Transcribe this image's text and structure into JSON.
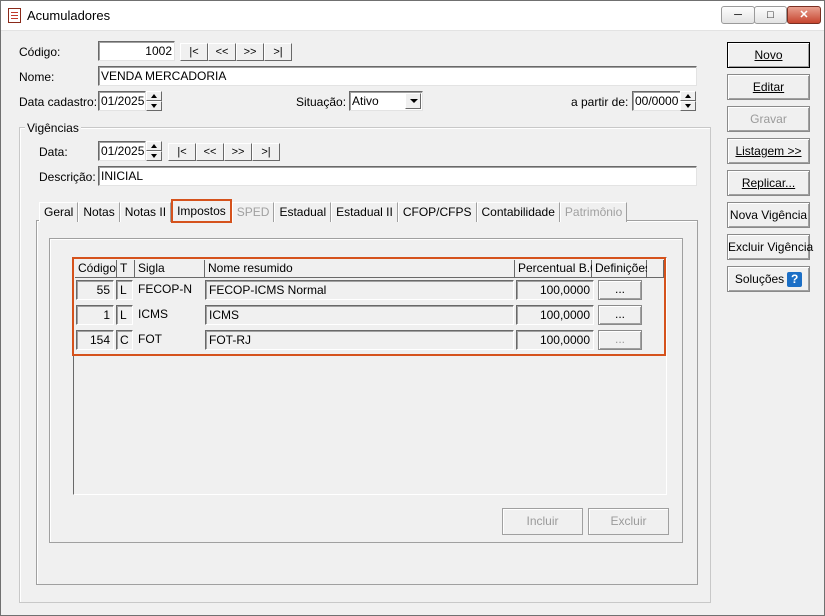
{
  "window": {
    "title": "Acumuladores"
  },
  "header": {
    "codigo_label": "Código:",
    "codigo_value": "1002",
    "nome_label": "Nome:",
    "nome_value": "VENDA MERCADORIA",
    "data_cadastro_label": "Data cadastro:",
    "data_cadastro_value": "01/2025",
    "situacao_label": "Situação:",
    "situacao_value": "Ativo",
    "a_partir_label": "a partir de:",
    "a_partir_value": "00/0000",
    "nav": [
      "|<",
      "<<",
      ">>",
      ">|"
    ]
  },
  "vigencias": {
    "title": "Vigências",
    "data_label": "Data:",
    "data_value": "01/2025",
    "descricao_label": "Descrição:",
    "descricao_value": "INICIAL",
    "nav": [
      "|<",
      "<<",
      ">>",
      ">|"
    ]
  },
  "tabs": [
    {
      "label": "Geral",
      "state": "normal"
    },
    {
      "label": "Notas",
      "state": "normal"
    },
    {
      "label": "Notas II",
      "state": "normal"
    },
    {
      "label": "Impostos",
      "state": "active"
    },
    {
      "label": "SPED",
      "state": "disabled"
    },
    {
      "label": "Estadual",
      "state": "normal"
    },
    {
      "label": "Estadual II",
      "state": "normal"
    },
    {
      "label": "CFOP/CFPS",
      "state": "normal"
    },
    {
      "label": "Contabilidade",
      "state": "normal"
    },
    {
      "label": "Patrimônio",
      "state": "disabled"
    }
  ],
  "grid": {
    "columns": [
      "Código",
      "T",
      "Sigla",
      "Nome resumido",
      "Percentual B.C.",
      "Definições"
    ],
    "rows": [
      {
        "codigo": "55",
        "t": "L",
        "sigla": "FECOP-N",
        "nome": "FECOP-ICMS Normal",
        "percentual": "100,0000",
        "definicoes": "...",
        "def_enabled": true
      },
      {
        "codigo": "1",
        "t": "L",
        "sigla": "ICMS",
        "nome": "ICMS",
        "percentual": "100,0000",
        "definicoes": "...",
        "def_enabled": true
      },
      {
        "codigo": "154",
        "t": "C",
        "sigla": "FOT",
        "nome": "FOT-RJ",
        "percentual": "100,0000",
        "definicoes": "...",
        "def_enabled": false
      }
    ]
  },
  "grid_buttons": {
    "incluir": "Incluir",
    "excluir": "Excluir"
  },
  "side_buttons": [
    {
      "label": "Novo",
      "state": "default"
    },
    {
      "label": "Editar",
      "state": "normal"
    },
    {
      "label": "Gravar",
      "state": "disabled"
    },
    {
      "label": "Listagem >>",
      "state": "normal"
    },
    {
      "label": "Replicar...",
      "state": "normal"
    },
    {
      "label": "Nova Vigência",
      "state": "normal"
    },
    {
      "label": "Excluir Vigência",
      "state": "normal"
    },
    {
      "label": "Soluções",
      "state": "normal",
      "icon": "help-icon"
    }
  ],
  "colors": {
    "highlight": "#d5521c",
    "window_bg": "#f0f0f0",
    "help_icon": "#1b6fc6"
  }
}
